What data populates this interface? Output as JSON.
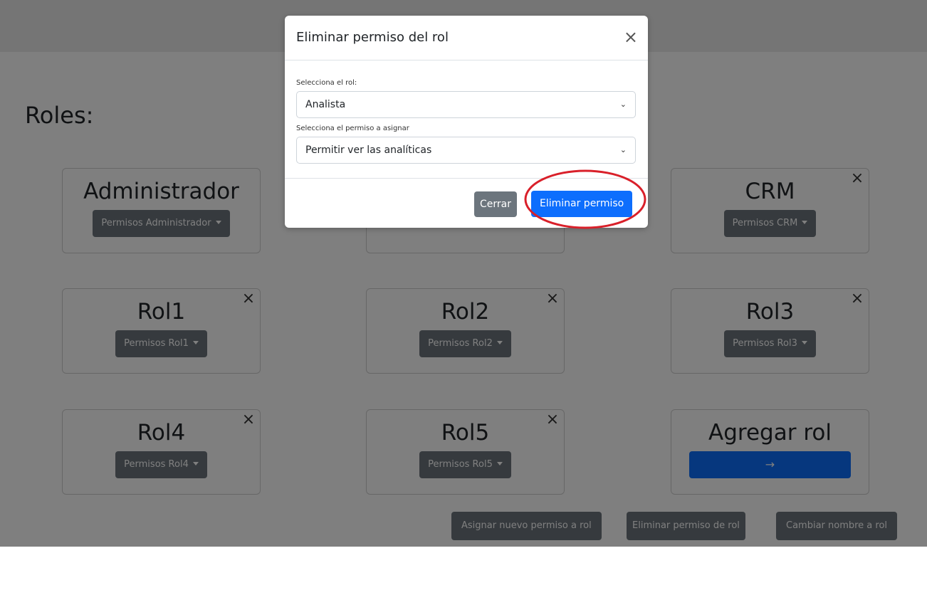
{
  "page": {
    "title": "Roles:"
  },
  "roles": [
    {
      "name": "Administrador",
      "button": "Permisos Administrador",
      "deletable": false
    },
    {
      "name": "",
      "button": "",
      "deletable": false
    },
    {
      "name": "CRM",
      "button": "Permisos CRM",
      "deletable": true
    },
    {
      "name": "Rol1",
      "button": "Permisos Rol1",
      "deletable": true
    },
    {
      "name": "Rol2",
      "button": "Permisos Rol2",
      "deletable": true
    },
    {
      "name": "Rol3",
      "button": "Permisos Rol3",
      "deletable": true
    },
    {
      "name": "Rol4",
      "button": "Permisos Rol4",
      "deletable": true
    },
    {
      "name": "Rol5",
      "button": "Permisos Rol5",
      "deletable": true
    }
  ],
  "add_role": {
    "title": "Agregar rol",
    "button_icon": "→"
  },
  "footer": {
    "assign": "Asignar nuevo permiso a rol",
    "remove": "Eliminar permiso de rol",
    "rename": "Cambiar nombre a rol"
  },
  "modal": {
    "title": "Eliminar permiso del rol",
    "close_icon": "×",
    "role_label": "Selecciona el rol:",
    "role_value": "Analista",
    "permission_label": "Selecciona el permiso a asignar",
    "permission_value": "Permitir ver las analíticas",
    "chevron_icon": "⌄",
    "cancel": "Cerrar",
    "confirm": "Eliminar permiso"
  },
  "icons": {
    "close": "×",
    "chevron": "chevron-down-icon",
    "arrow": "arrow-right-icon"
  },
  "colors": {
    "primary": "#0d6efd",
    "secondary": "#6c757d",
    "highlight": "#d9202a"
  }
}
